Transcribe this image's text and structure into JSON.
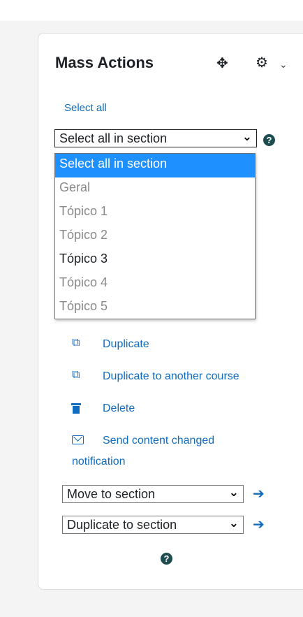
{
  "block": {
    "title": "Mass Actions",
    "move_icon": "move-icon",
    "gear_icon": "gear-icon"
  },
  "select_all_label": "Select all",
  "section_select": {
    "value": "Select all in section",
    "options": [
      "Select all in section",
      "Geral",
      "Tópico 1",
      "Tópico 2",
      "Tópico 3",
      "Tópico 4",
      "Tópico 5"
    ],
    "highlighted_index": 0
  },
  "actions": {
    "duplicate": "Duplicate",
    "duplicate_course": "Duplicate to another course",
    "delete": "Delete",
    "send_line1": "Send content changed",
    "send_line2": "notification"
  },
  "move_select": {
    "value": "Move to section"
  },
  "dup_select": {
    "value": "Duplicate to section"
  },
  "colors": {
    "link": "#0f6cbf",
    "highlight": "#1e90ff",
    "help_icon": "#1d4d50"
  }
}
